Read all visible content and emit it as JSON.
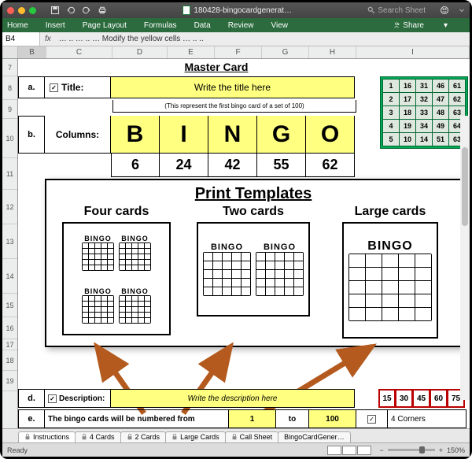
{
  "titlebar": {
    "docname": "180428-bingocardgenerat…",
    "search_placeholder": "Search Sheet"
  },
  "menu": [
    "Home",
    "Insert",
    "Page Layout",
    "Formulas",
    "Data",
    "Review",
    "View"
  ],
  "share_label": "Share",
  "formula": {
    "cell": "B4",
    "text": "… .. … .. … Modify the yellow cells … .. .."
  },
  "columns": [
    "B",
    "C",
    "D",
    "E",
    "F",
    "G",
    "H",
    "I"
  ],
  "rows": [
    "7",
    "8",
    "9",
    "10",
    "11",
    "12",
    "13",
    "14",
    "15",
    "16",
    "17",
    "18",
    "19"
  ],
  "master": {
    "heading": "Master Card",
    "a_label": "a.",
    "title_label": "Title:",
    "title_input": "Write the title here",
    "note": "(This represent the first bingo card of a set of 100)",
    "b_label": "b.",
    "columns_label": "Columns:",
    "letters": [
      "B",
      "I",
      "N",
      "G",
      "O"
    ],
    "nums": [
      "6",
      "24",
      "42",
      "55",
      "62"
    ]
  },
  "minicard_rows": [
    [
      "1",
      "16",
      "31",
      "46",
      "61"
    ],
    [
      "2",
      "17",
      "32",
      "47",
      "62"
    ],
    [
      "3",
      "18",
      "33",
      "48",
      "63"
    ],
    [
      "4",
      "19",
      "34",
      "49",
      "64"
    ],
    [
      "5",
      "10",
      "14",
      "51",
      "63"
    ]
  ],
  "overlay": {
    "title": "Print Templates",
    "col1": "Four cards",
    "col2": "Two cards",
    "col3": "Large cards",
    "bingo_label": "BINGO"
  },
  "row18": {
    "d_label": "d.",
    "desc_label": "Description:",
    "desc_input": "Write the description here"
  },
  "red_strip": [
    "15",
    "30",
    "45",
    "60",
    "75"
  ],
  "row19": {
    "e_label": "e.",
    "text": "The bingo cards will be numbered from",
    "from": "1",
    "to_label": "to",
    "to": "100",
    "corners": "4 Corners"
  },
  "tabs": [
    "Instructions",
    "4 Cards",
    "2 Cards",
    "Large Cards",
    "Call Sheet",
    "BingoCardGener…"
  ],
  "status": {
    "ready": "Ready",
    "zoom": "150%"
  }
}
